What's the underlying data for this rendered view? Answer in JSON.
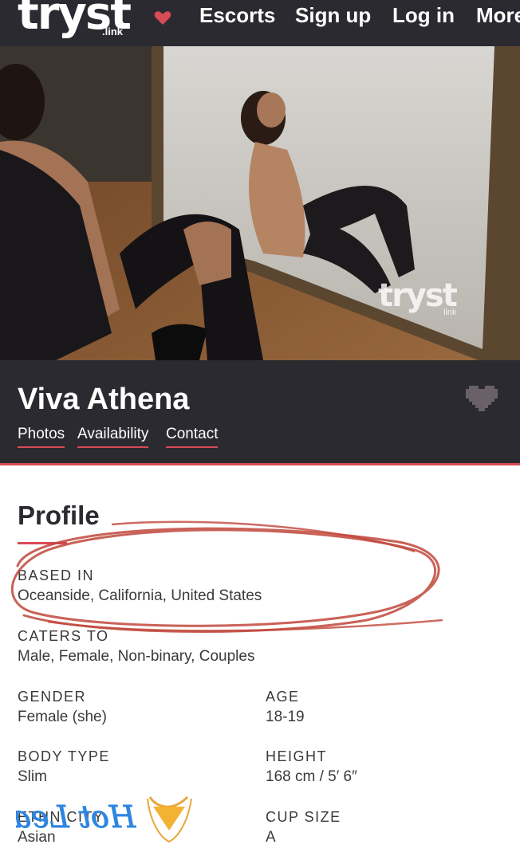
{
  "nav": {
    "logo": "tryst",
    "logo_sub": ".link",
    "links": [
      "Escorts",
      "Sign up",
      "Log in",
      "More"
    ],
    "accent": "#d94a57",
    "background": "#2b2a30"
  },
  "hero": {
    "watermark": "tryst",
    "watermark_sub": "link"
  },
  "banner": {
    "name": "Viva Athena",
    "tabs": [
      "Photos",
      "Availability",
      "Contact"
    ]
  },
  "profile": {
    "heading": "Profile",
    "based_in": {
      "label": "BASED IN",
      "value": "Oceanside, California, United States"
    },
    "caters_to": {
      "label": "CATERS TO",
      "value": "Male, Female, Non-binary, Couples"
    },
    "gender": {
      "label": "GENDER",
      "value": "Female (she)"
    },
    "age": {
      "label": "AGE",
      "value": "18-19"
    },
    "body_type": {
      "label": "BODY TYPE",
      "value": "Slim"
    },
    "height": {
      "label": "HEIGHT",
      "value": "168 cm / 5′ 6″"
    },
    "ethnicity": {
      "label": "ETHNICITY",
      "value": "Asian"
    },
    "cup_size": {
      "label": "CUP SIZE",
      "value": "A"
    }
  },
  "sticker": {
    "text": "Hot Leak"
  }
}
